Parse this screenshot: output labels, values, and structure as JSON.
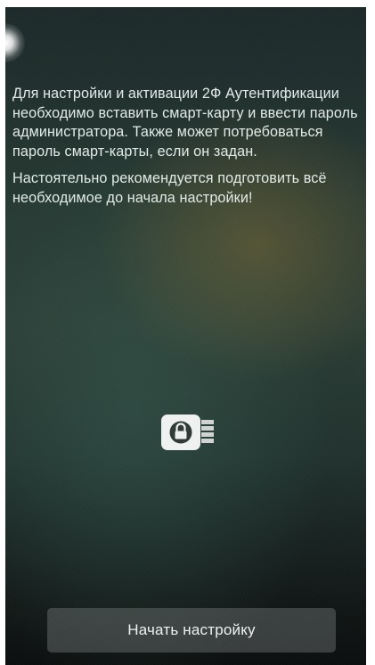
{
  "intro": {
    "paragraph_1": "Для настройки и активации 2Ф Аутентификации необходимо вставить смарт-карту и ввести пароль администратора. Также может потребоваться пароль смарт-карты, если он задан.",
    "paragraph_2": "Настоятельно рекомендуется подготовить всё необходимое до начала настройки!"
  },
  "illustration": {
    "icon": "smart-card-lock-icon"
  },
  "actions": {
    "start_label": "Начать настройку"
  }
}
